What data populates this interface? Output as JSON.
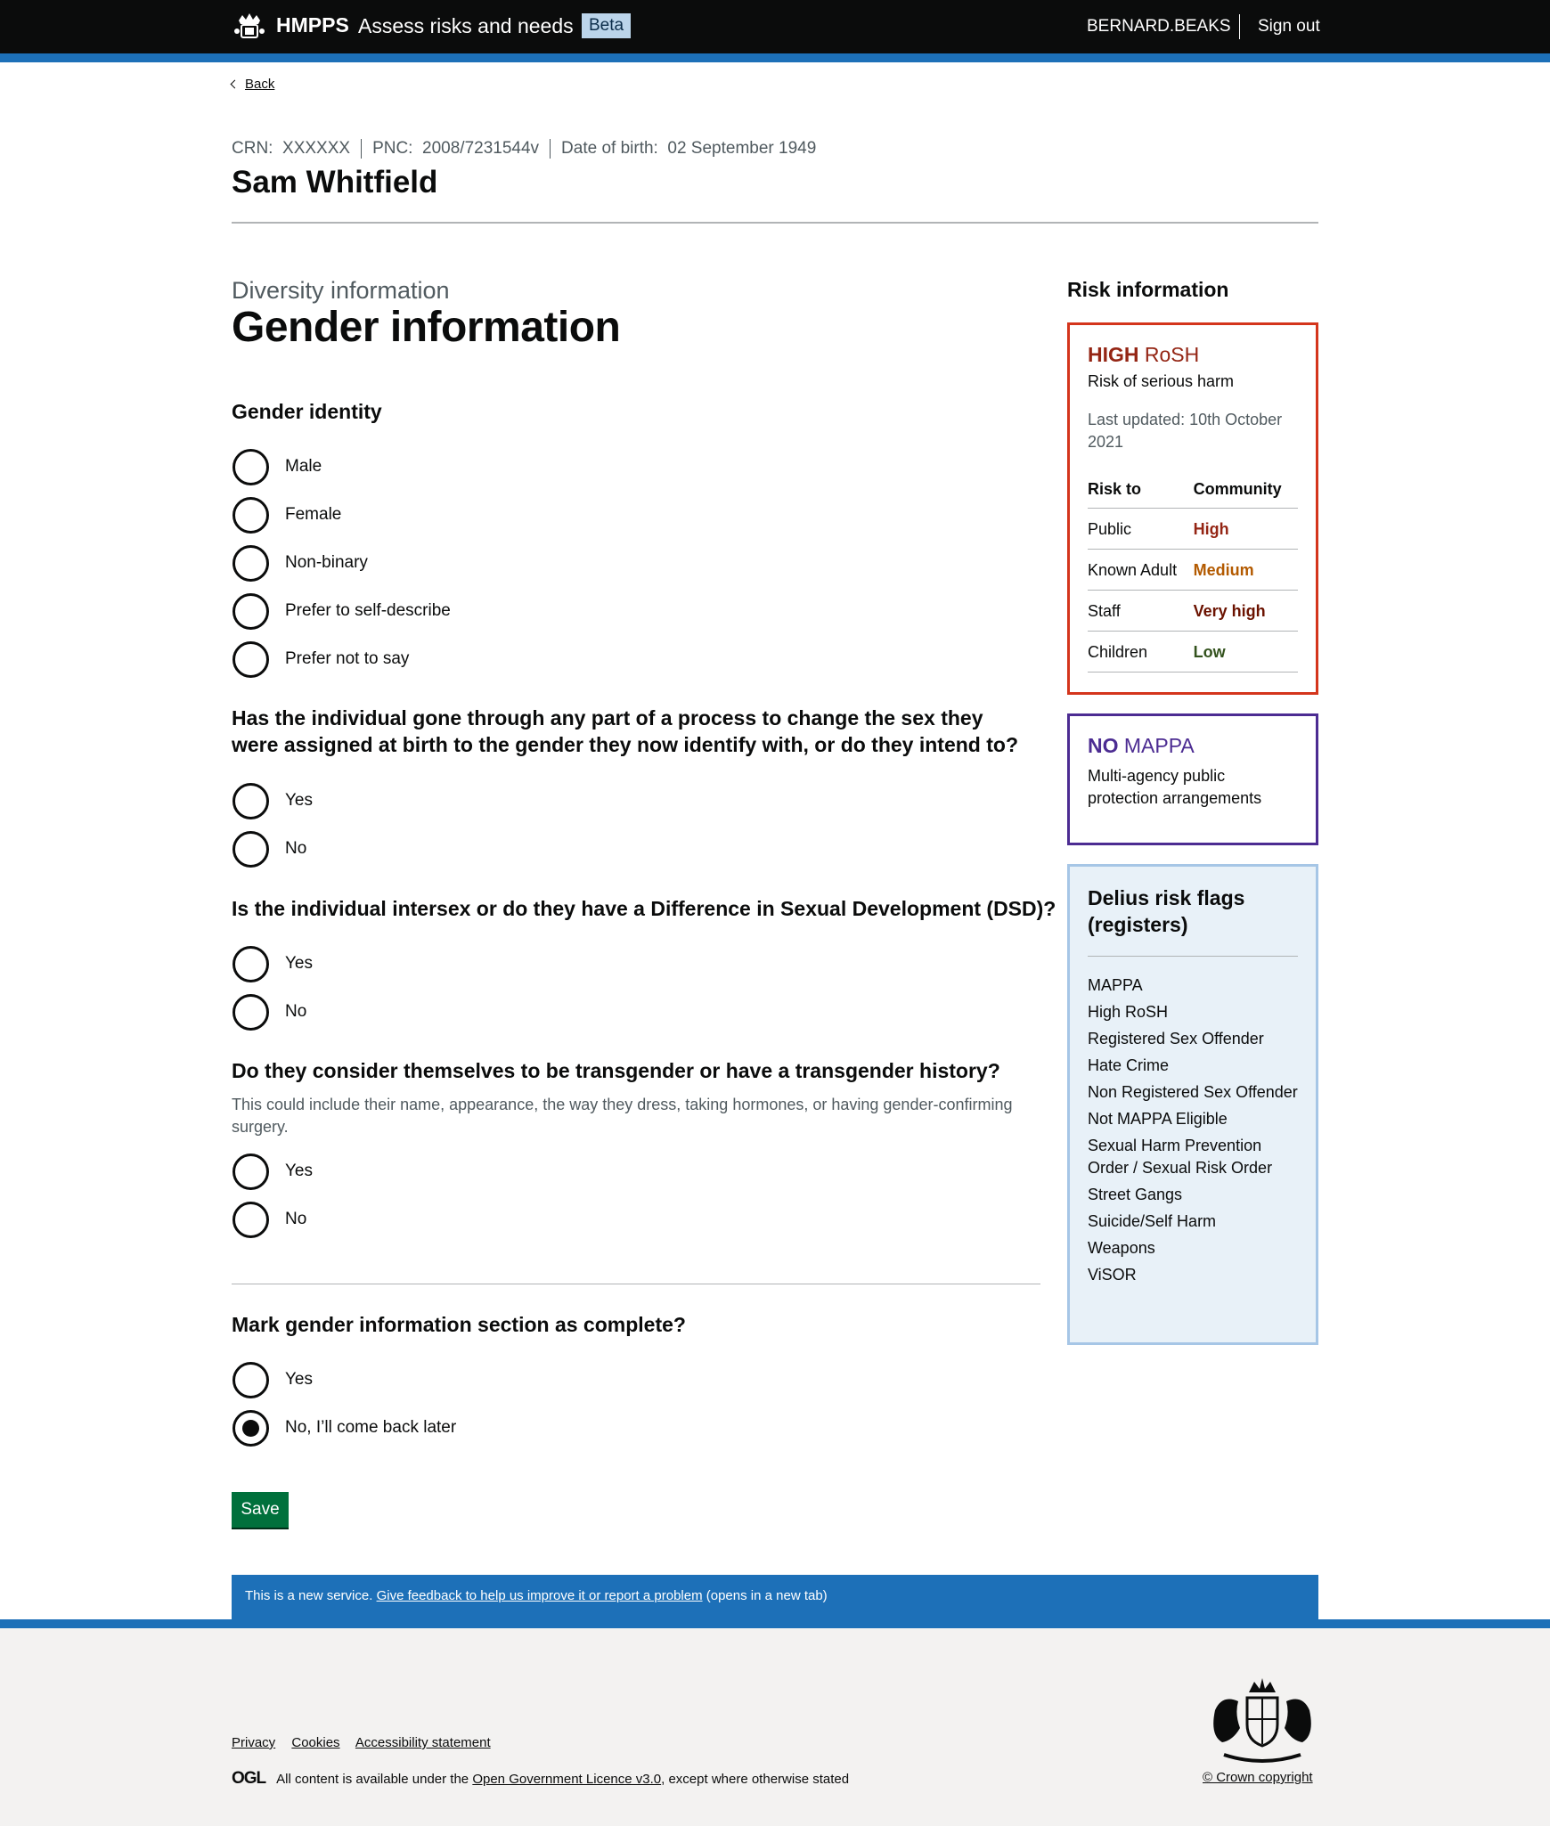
{
  "header": {
    "brand": "HMPPS",
    "service": "Assess risks and needs",
    "phase": "Beta",
    "user": "BERNARD.BEAKS",
    "sign_out": "Sign out"
  },
  "back_link": "Back",
  "person": {
    "crn_label": "CRN:",
    "crn": "XXXXXX",
    "pnc_label": "PNC:",
    "pnc": "2008/7231544v",
    "dob_label": "Date of birth:",
    "dob": "02 September 1949",
    "name": "Sam Whitfield"
  },
  "page": {
    "caption": "Diversity information",
    "title": "Gender information"
  },
  "questions": {
    "gender_identity": {
      "label": "Gender identity",
      "options": [
        "Male",
        "Female",
        "Non-binary",
        "Prefer to self-describe",
        "Prefer not to say"
      ]
    },
    "process": {
      "label": "Has the individual gone through any part of a process to change the sex they were assigned at birth to the gender they now identify with, or do they intend to?",
      "options": [
        "Yes",
        "No"
      ]
    },
    "intersex": {
      "label": "Is the individual intersex or do they have a Difference in Sexual Development (DSD)?",
      "options": [
        "Yes",
        "No"
      ]
    },
    "transgender": {
      "label": "Do they consider themselves to be transgender or have a transgender history?",
      "hint": "This could include their name, appearance, the way they dress, taking hormones, or having gender-confirming surgery.",
      "options": [
        "Yes",
        "No"
      ]
    },
    "complete": {
      "label": "Mark gender information section as complete?",
      "options": [
        "Yes",
        "No, I’ll come back later"
      ],
      "selected": "No, I’ll come back later"
    }
  },
  "save_label": "Save",
  "risk": {
    "heading": "Risk information",
    "rosh": {
      "level": "HIGH",
      "label": "RoSH",
      "subtitle": "Risk of serious harm",
      "updated": "Last updated: 10th October 2021",
      "col_risk": "Risk to",
      "col_community": "Community",
      "rows": [
        {
          "to": "Public",
          "level": "High",
          "color": "#942514"
        },
        {
          "to": "Known Adult",
          "level": "Medium",
          "color": "#b35a00"
        },
        {
          "to": "Staff",
          "level": "Very high",
          "color": "#6b1200"
        },
        {
          "to": "Children",
          "level": "Low",
          "color": "#33521d"
        }
      ]
    },
    "mappa": {
      "level": "NO",
      "label": "MAPPA",
      "subtitle": "Multi-agency public protection arrangements"
    },
    "flags": {
      "title": "Delius risk flags (registers)",
      "items": [
        "MAPPA",
        "High RoSH",
        "Registered Sex Offender",
        "Hate Crime",
        "Non Registered Sex Offender",
        "Not MAPPA Eligible",
        "Sexual Harm Prevention Order / Sexual Risk Order",
        "Street Gangs",
        "Suicide/Self Harm",
        "Weapons",
        "ViSOR"
      ]
    }
  },
  "feedback": {
    "prefix": "This is a new service.",
    "link": "Give feedback to help us improve it or report a problem",
    "suffix": "(opens in a new tab)"
  },
  "footer": {
    "links": [
      "Privacy",
      "Cookies",
      "Accessibility statement"
    ],
    "ogl_logo": "OGL",
    "licence_prefix": "All content is available under the",
    "licence_link": "Open Government Licence v3.0",
    "licence_suffix": ", except where otherwise stated",
    "copyright": "© Crown copyright"
  }
}
